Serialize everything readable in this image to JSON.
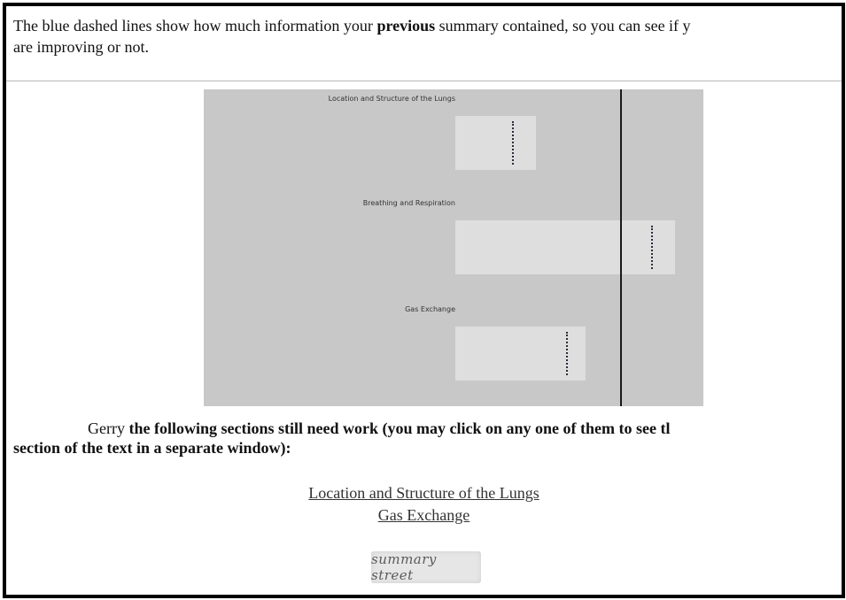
{
  "intro": {
    "line1_pre": "The blue dashed lines show how much information your ",
    "line1_bold": "previous",
    "line1_post": " summary contained, so you can see if y",
    "line2": "are improving or not."
  },
  "chart_data": {
    "type": "bar",
    "orientation": "horizontal",
    "categories": [
      "Location and Structure of the Lungs",
      "Breathing and Respiration",
      "Gas Exchange"
    ],
    "values": [
      0.325,
      0.885,
      0.525
    ],
    "previous_values": [
      0.23,
      0.79,
      0.445
    ],
    "target": 0.665,
    "xlim": [
      0,
      1
    ],
    "grid": false,
    "legend": "none"
  },
  "need": {
    "name": "Gerry",
    "line1_rest": " the following sections still need work (you may click on any one of them to see tl",
    "line2": "section of the text in a separate window):"
  },
  "links": [
    "Location and Structure of the Lungs",
    "Gas Exchange"
  ],
  "logo_text": "summary street"
}
